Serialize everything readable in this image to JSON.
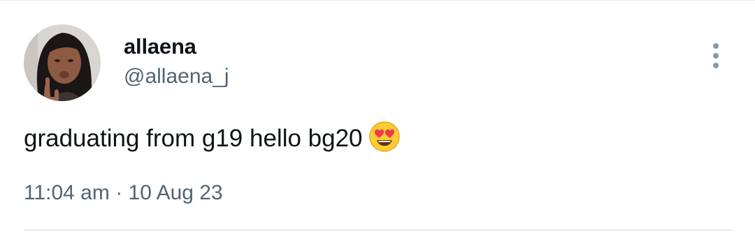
{
  "tweet": {
    "author": {
      "display_name": "allaena",
      "handle": "@allaena_j",
      "avatar_icon": "user-avatar-photo"
    },
    "text": "graduating from g19 hello bg20",
    "emoji": "smiling-face-with-heart-eyes",
    "time": "11:04 am",
    "separator": "·",
    "date": "10 Aug 23",
    "more_icon": "vertical-ellipsis-icon"
  },
  "colors": {
    "primary_text": "#0f1419",
    "secondary_text": "#536471",
    "divider": "#e6e9ec",
    "more_icon": "#8b98a5"
  }
}
